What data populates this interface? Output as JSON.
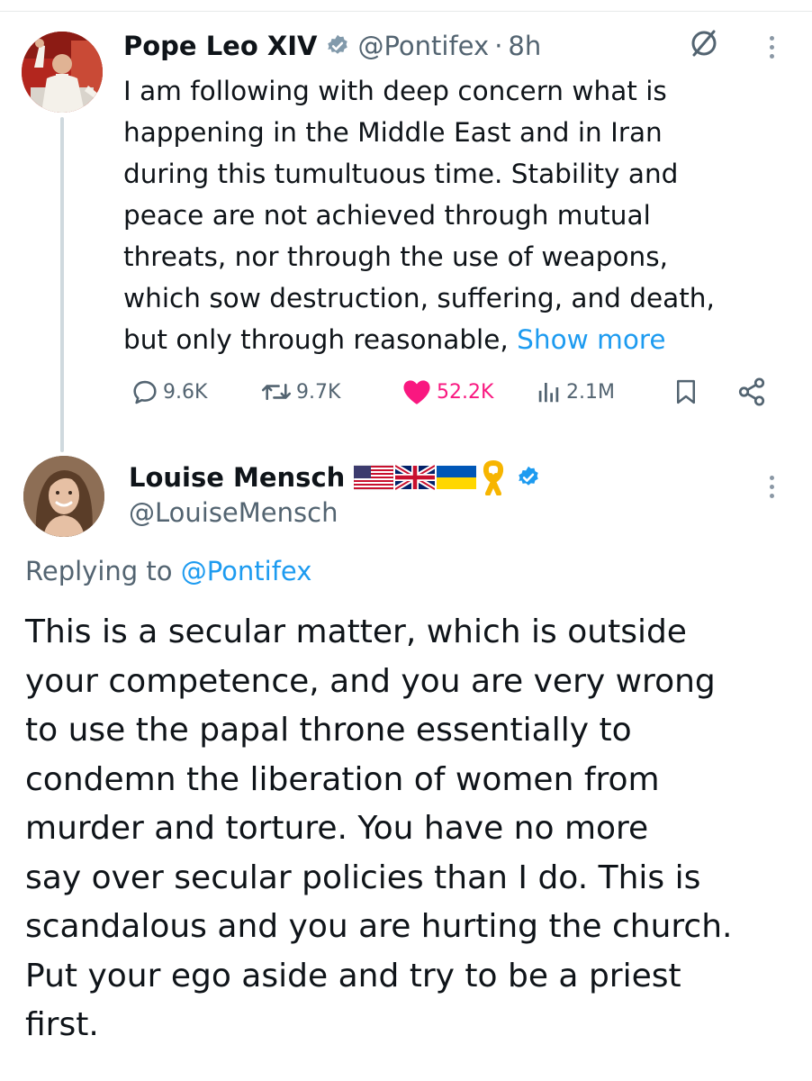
{
  "parent_tweet": {
    "author_name": "Pope Leo XIV",
    "handle": "@Pontifex",
    "separator": "·",
    "time": "8h",
    "text_lines": [
      "I am following with deep concern what is",
      "happening in the Middle East and in Iran",
      "during this tumultuous time. Stability and",
      "peace are not achieved through mutual",
      "threats, nor through the use of weapons,",
      "which sow destruction, suffering, and death,",
      "but only through reasonable, "
    ],
    "show_more": "Show more",
    "metrics": {
      "replies": "9.6K",
      "reposts": "9.7K",
      "likes": "52.2K",
      "views": "2.1M"
    }
  },
  "reply_tweet": {
    "author_name": "Louise Mensch",
    "handle": "@LouiseMensch",
    "replying_prefix": "Replying to ",
    "replying_to": "@Pontifex",
    "text_lines": [
      "This is a secular matter, which is outside",
      "your competence, and you are very wrong",
      "to use the papal throne essentially to",
      "condemn the liberation of women from",
      "murder and torture. You have no more",
      "say over secular policies than I do. This is",
      "scandalous and you are hurting the church.",
      "Put your ego aside and try to be a priest",
      "first."
    ]
  },
  "colors": {
    "link_blue": "#1d9bf0",
    "like_pink": "#f91880",
    "muted_gray": "#536471",
    "thread_line": "#cfd9de",
    "verified_gray": "#829aab",
    "verified_blue": "#1d9bf0"
  },
  "icons": {
    "reply": "speech-bubble-icon",
    "repost": "repost-arrows-icon",
    "like": "heart-filled-icon",
    "views": "bar-chart-icon",
    "bookmark": "bookmark-icon",
    "share": "share-nodes-icon",
    "grok": "grok-slash-circle-icon",
    "more": "vertical-dots-icon"
  }
}
